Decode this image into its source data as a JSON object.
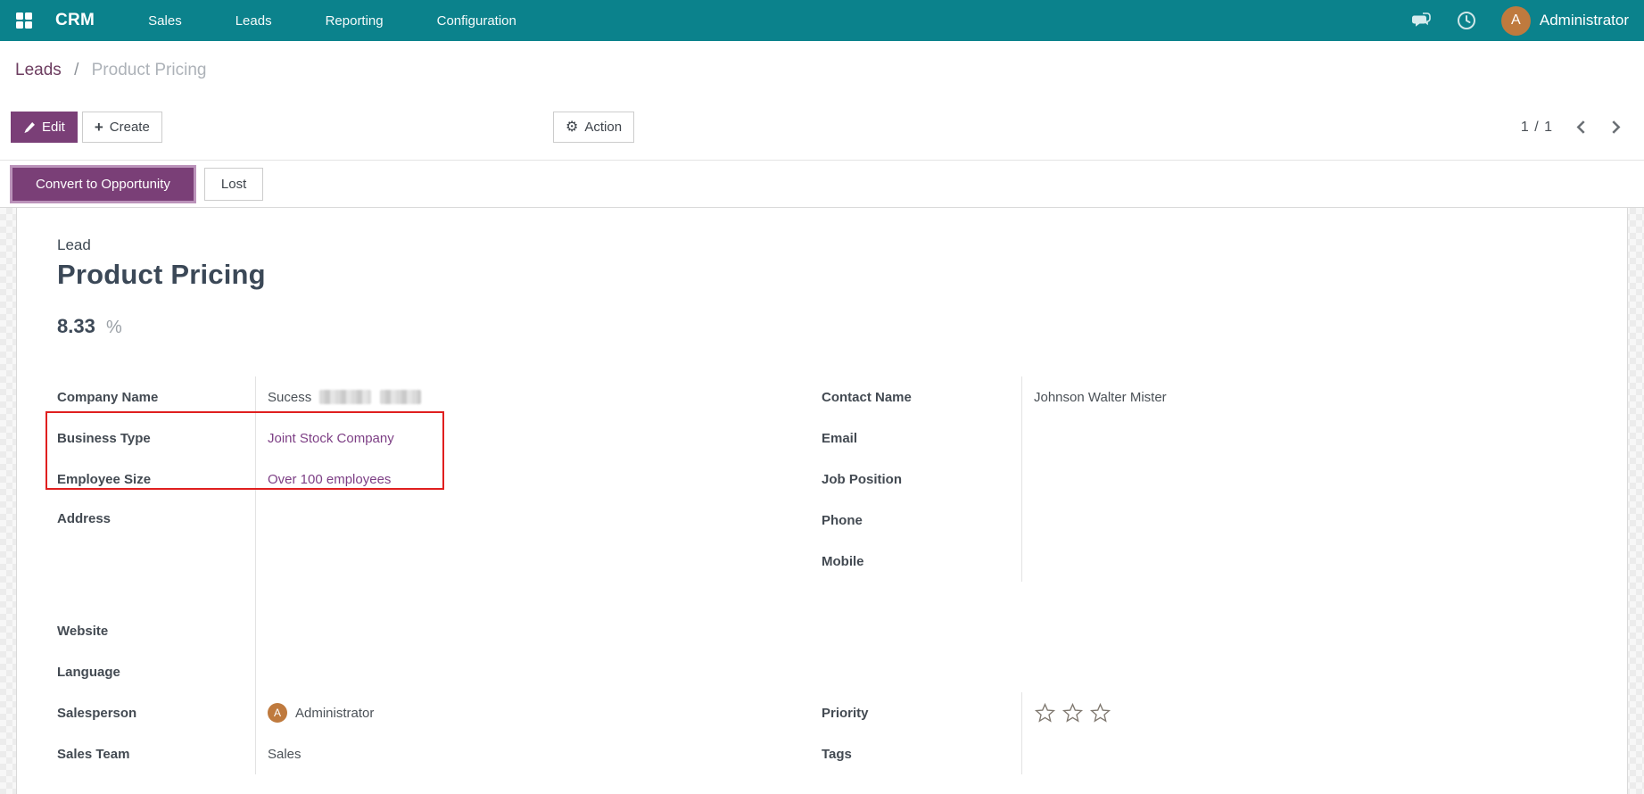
{
  "navbar": {
    "app_name": "CRM",
    "menu": [
      "Sales",
      "Leads",
      "Reporting",
      "Configuration"
    ],
    "user": {
      "name": "Administrator",
      "avatar_letter": "A"
    },
    "icons": [
      "apps-grid",
      "messages",
      "activities-clock"
    ]
  },
  "breadcrumb": {
    "parent": "Leads",
    "separator": "/",
    "current": "Product Pricing"
  },
  "control_panel": {
    "edit": "Edit",
    "create": "Create",
    "action": "Action",
    "pager": "1 / 1",
    "icons": {
      "plus": "+",
      "gear": "⚙"
    }
  },
  "status_actions": {
    "convert": "Convert to Opportunity",
    "lost": "Lost"
  },
  "form": {
    "record_type": "Lead",
    "title": "Product Pricing",
    "probability": {
      "value": "8.33",
      "unit": "%"
    },
    "fields": {
      "company_name": {
        "label": "Company Name",
        "value": "Sucess",
        "value_note": "rest of value pixelated/blurred"
      },
      "business_type": {
        "label": "Business Type",
        "value": "Joint Stock Company"
      },
      "employee_size": {
        "label": "Employee Size",
        "value": "Over 100 employees"
      },
      "address": {
        "label": "Address",
        "value": ""
      },
      "website": {
        "label": "Website",
        "value": ""
      },
      "language": {
        "label": "Language",
        "value": ""
      },
      "salesperson": {
        "label": "Salesperson",
        "value": "Administrator",
        "avatar_letter": "A"
      },
      "sales_team": {
        "label": "Sales Team",
        "value": "Sales"
      },
      "contact_name": {
        "label": "Contact Name",
        "value": "Johnson Walter Mister"
      },
      "email": {
        "label": "Email",
        "value": ""
      },
      "job_position": {
        "label": "Job Position",
        "value": ""
      },
      "phone": {
        "label": "Phone",
        "value": ""
      },
      "mobile": {
        "label": "Mobile",
        "value": ""
      },
      "priority": {
        "label": "Priority",
        "stars_total": 3,
        "stars_filled": 0
      },
      "tags": {
        "label": "Tags",
        "value": ""
      }
    }
  },
  "colors": {
    "navbar_bg": "#0b828c",
    "primary_purple": "#7a3f77",
    "highlight_ring": "#bb93ba",
    "link_purple": "#7d3f85",
    "breadcrumb_link": "#6d3d60",
    "red_highlight_box": "#e01f1f",
    "avatar_orange": "#bf7a3e"
  }
}
